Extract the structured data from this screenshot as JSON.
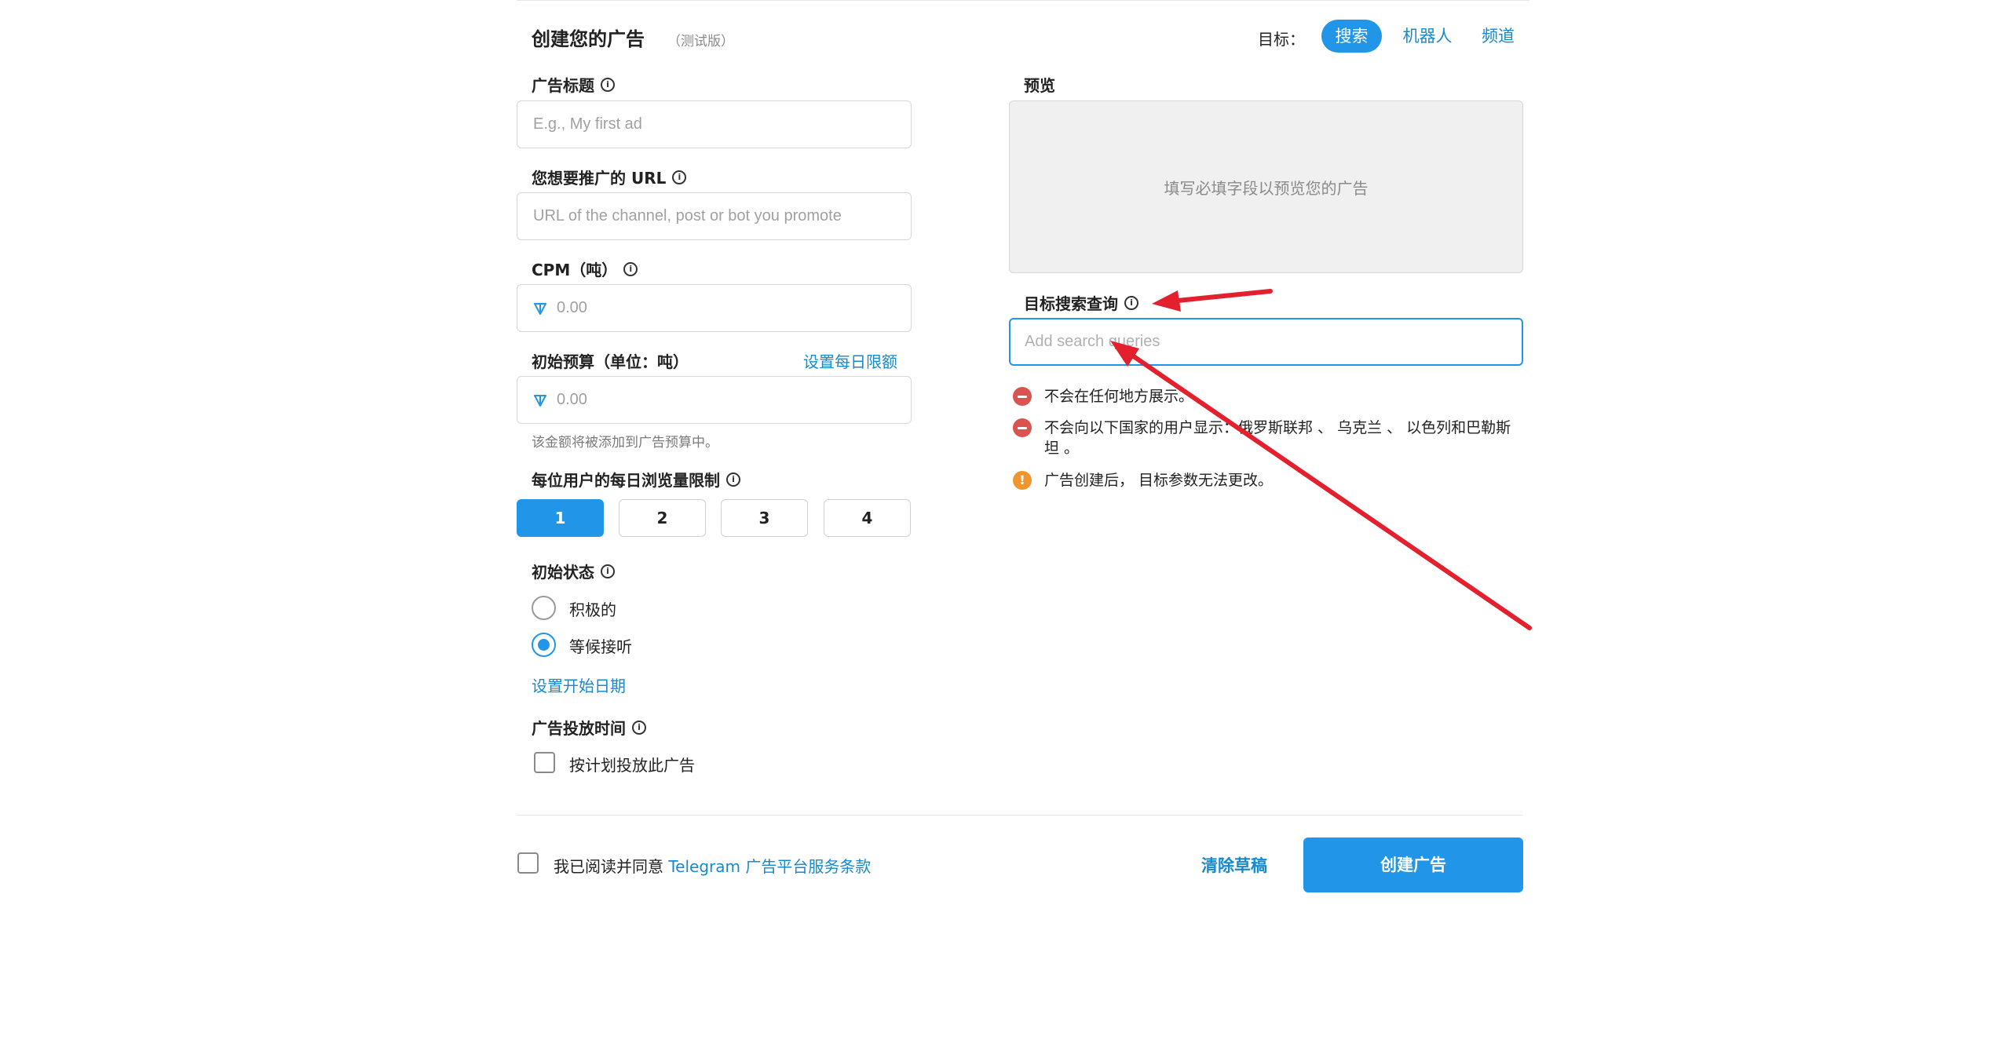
{
  "header": {
    "title": "创建您的广告",
    "beta": "（测试版）",
    "target_label": "目标：",
    "target_tabs": [
      "搜索",
      "机器人",
      "频道"
    ]
  },
  "form": {
    "ad_title": {
      "label": "广告标题",
      "placeholder": "E.g., My first ad",
      "value": ""
    },
    "url": {
      "label": "您想要推广的 URL",
      "placeholder": "URL of the channel, post or bot you promote",
      "value": ""
    },
    "cpm": {
      "label": "CPM（吨）",
      "placeholder": "0.00",
      "value": ""
    },
    "budget": {
      "label": "初始预算（单位：吨）",
      "daily_limit_link": "设置每日限额",
      "placeholder": "0.00",
      "value": "",
      "hint": "该金额将被添加到广告预算中。"
    },
    "views_limit": {
      "label": "每位用户的每日浏览量限制",
      "options": [
        "1",
        "2",
        "3",
        "4"
      ],
      "selected": "1"
    },
    "initial_status": {
      "label": "初始状态",
      "options": [
        "积极的",
        "等候接听"
      ],
      "selected": "等候接听",
      "start_date_link": "设置开始日期"
    },
    "schedule": {
      "label": "广告投放时间",
      "checkbox_label": "按计划投放此广告",
      "checked": false
    }
  },
  "preview": {
    "label": "预览",
    "placeholder": "填写必填字段以预览您的广告"
  },
  "search_queries": {
    "label": "目标搜索查询",
    "placeholder": "Add search queries",
    "value": ""
  },
  "notes": [
    {
      "type": "error",
      "text": "不会在任何地方展示。"
    },
    {
      "type": "error",
      "text": "不会向以下国家的用户显示：俄罗斯联邦 、 乌克兰 、 以色列和巴勒斯坦 。"
    },
    {
      "type": "warning",
      "icon": "!",
      "text": "广告创建后， 目标参数无法更改。"
    }
  ],
  "footer": {
    "agree_prefix": "我已阅读并同意 ",
    "agree_link": "Telegram 广告平台服务条款",
    "agree_checked": false,
    "clear_label": "清除草稿",
    "create_label": "创建广告"
  },
  "colors": {
    "accent": "#2196e8",
    "link": "#168acd",
    "error": "#d9534f",
    "warning": "#f0962e",
    "annotation_arrow": "#e3202e"
  }
}
